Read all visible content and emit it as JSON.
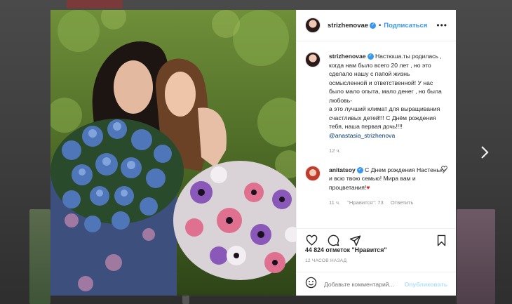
{
  "post": {
    "author": "strizhenovae",
    "follow_label": "Подписаться",
    "dot": "•",
    "caption_lines": [
      "Настюша.ты родилась , когда нам было всего 20 лет , но это сделало нашу с папой жизнь осмысленной и ответственной! У нас было мало опыта, мало денег , но была любовь-",
      "а это лучший климат для выращивания счастливых детей!!! С Днём рождения тебя, наша первая дочь!!!! "
    ],
    "caption_mention": "@anastasia_strizhenova",
    "caption_time": "12 ч."
  },
  "comment": {
    "author": "anitatsoy",
    "text": "С Днем рождения Настеньку и всю твою семью! Мира вам и процветания!",
    "heart": "♥",
    "time": "11 ч.",
    "likes": "\"Нравится\": 73",
    "reply": "Ответить"
  },
  "likes_text": "44 824 отметок \"Нравится\"",
  "date_text": "12 ЧАСОВ НАЗАД",
  "comment_box": {
    "placeholder": "Добавьте комментарий...",
    "publish_label": "Опубликовать"
  },
  "icons": [
    "verified-icon",
    "more-icon",
    "heart-icon",
    "comment-icon",
    "share-icon",
    "bookmark-icon",
    "emoji-icon",
    "next-arrow-icon"
  ],
  "colors": {
    "accent": "#3897f0",
    "publish_disabled": "#b2dffc",
    "heart": "#ed1c24"
  }
}
